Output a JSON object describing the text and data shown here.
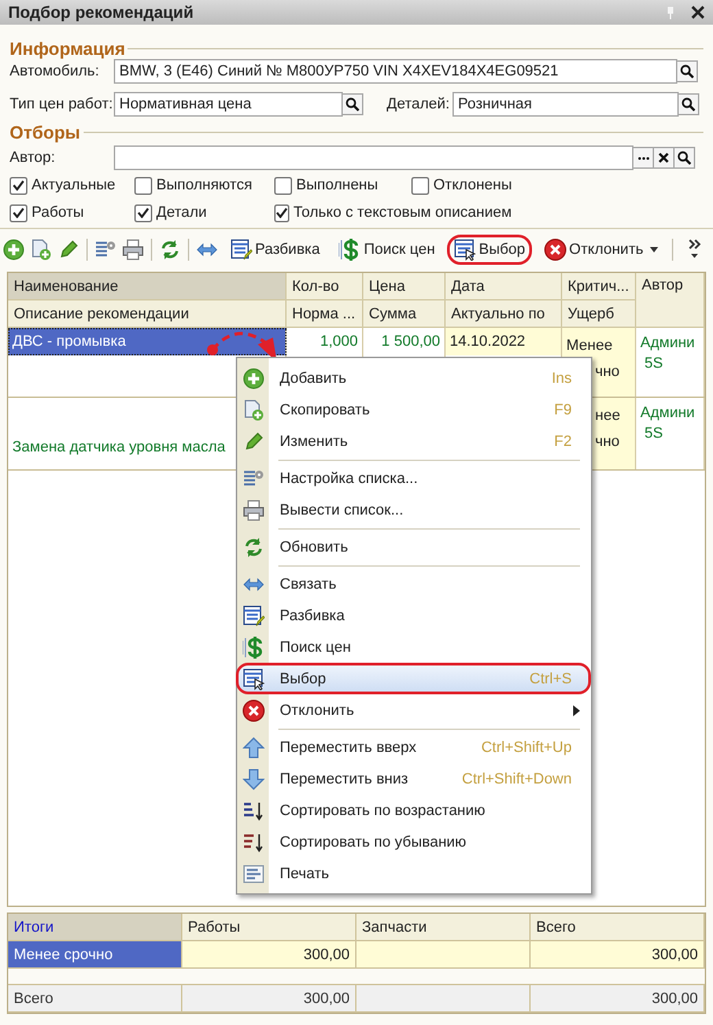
{
  "window": {
    "title": "Подбор рекомендаций"
  },
  "info": {
    "heading": "Информация",
    "car": {
      "label": "Автомобиль:",
      "value": "BMW, 3 (E46) Синий № М800УР750 VIN X4XEV184X4EG09521"
    },
    "work_price": {
      "label": "Тип цен работ:",
      "value": "Нормативная цена"
    },
    "parts_price": {
      "label": "Деталей:",
      "value": "Розничная"
    }
  },
  "filters": {
    "heading": "Отборы",
    "author": {
      "label": "Автор:"
    },
    "checkboxes": [
      {
        "label": "Актуальные",
        "checked": true
      },
      {
        "label": "Выполняются",
        "checked": false
      },
      {
        "label": "Выполнены",
        "checked": false
      },
      {
        "label": "Отклонены",
        "checked": false
      },
      {
        "label": "Работы",
        "checked": true
      },
      {
        "label": "Детали",
        "checked": true
      },
      {
        "label": "Только с текстовым описанием",
        "checked": true
      }
    ]
  },
  "toolbar": [
    {
      "kind": "add"
    },
    {
      "kind": "copy"
    },
    {
      "kind": "edit"
    },
    {
      "kind": "separator"
    },
    {
      "kind": "settings"
    },
    {
      "kind": "print"
    },
    {
      "kind": "separator"
    },
    {
      "kind": "refresh"
    },
    {
      "kind": "separator"
    },
    {
      "kind": "link"
    },
    {
      "kind": "split",
      "label": "Разбивка",
      "highlighted": false
    },
    {
      "kind": "price",
      "label": "Поиск цен",
      "highlighted": false
    },
    {
      "kind": "select",
      "label": "Выбор",
      "highlighted": true
    },
    {
      "kind": "reject",
      "label": "Отклонить",
      "highlighted": false,
      "dropdown": true
    },
    {
      "kind": "separator"
    },
    {
      "kind": "more"
    }
  ],
  "table": {
    "header_top": [
      {
        "label": "Наименование",
        "sorted": true
      },
      {
        "label": "Кол-во",
        "sorted": false
      },
      {
        "label": "Цена",
        "sorted": false
      },
      {
        "label": "Дата",
        "sorted": false
      },
      {
        "label": "Критич...",
        "sorted": false
      },
      {
        "label": "Автор",
        "sorted": false
      }
    ],
    "header_bottom": [
      "Описание рекомендации",
      "Норма ...",
      "Сумма",
      "Актуально по",
      "Ущерб"
    ],
    "rows": [
      {
        "name": "ДВС - промывка",
        "selected": true,
        "qty": "1,000",
        "price": "1 500,00",
        "date": "14.10.2022",
        "criticality": [
          {
            "text": "Менее",
            "covered": false
          },
          {
            "text": "чно",
            "covered": true
          }
        ],
        "author": [
          "Админи",
          "5S"
        ]
      },
      {
        "description": "Замена датчика уровня масла",
        "selected": false,
        "criticality": [
          {
            "text": "нее",
            "covered": true
          },
          {
            "text": "чно",
            "covered": true
          }
        ],
        "author": [
          "Админи",
          "5S"
        ]
      }
    ]
  },
  "context_menu": [
    {
      "kind": "add",
      "label": "Добавить",
      "shortcut": "Ins",
      "selected": false
    },
    {
      "kind": "copy",
      "label": "Скопировать",
      "shortcut": "F9",
      "selected": false
    },
    {
      "kind": "edit",
      "label": "Изменить",
      "shortcut": "F2",
      "selected": false
    },
    {
      "kind": "separator"
    },
    {
      "kind": "settings",
      "label": "Настройка списка...",
      "selected": false
    },
    {
      "kind": "print",
      "label": "Вывести список...",
      "selected": false
    },
    {
      "kind": "separator"
    },
    {
      "kind": "refresh",
      "label": "Обновить",
      "selected": false
    },
    {
      "kind": "separator"
    },
    {
      "kind": "link",
      "label": "Связать",
      "selected": false
    },
    {
      "kind": "split",
      "label": "Разбивка",
      "selected": false
    },
    {
      "kind": "price",
      "label": "Поиск цен",
      "selected": false
    },
    {
      "kind": "select",
      "label": "Выбор",
      "shortcut": "Ctrl+S",
      "selected": true,
      "highlighted": true
    },
    {
      "kind": "reject",
      "label": "Отклонить",
      "selected": false,
      "submenu": true
    },
    {
      "kind": "separator"
    },
    {
      "kind": "up",
      "label": "Переместить вверх",
      "shortcut": "Ctrl+Shift+Up",
      "selected": false
    },
    {
      "kind": "down",
      "label": "Переместить вниз",
      "shortcut": "Ctrl+Shift+Down",
      "selected": false
    },
    {
      "kind": "sort_asc",
      "label": "Сортировать по возрастанию",
      "selected": false
    },
    {
      "kind": "sort_desc",
      "label": "Сортировать по убыванию",
      "selected": false
    },
    {
      "kind": "print_list",
      "label": "Печать",
      "selected": false
    }
  ],
  "totals": {
    "columns": [
      "Итоги",
      "Работы",
      "Запчасти",
      "Всего"
    ],
    "rows": [
      {
        "kind": "group",
        "label": "Менее срочно",
        "selected": true,
        "works": "300,00",
        "total": "300,00"
      },
      {
        "kind": "blank"
      },
      {
        "kind": "total",
        "label": "Всего",
        "works": "300,00",
        "total": "300,00"
      }
    ]
  }
}
